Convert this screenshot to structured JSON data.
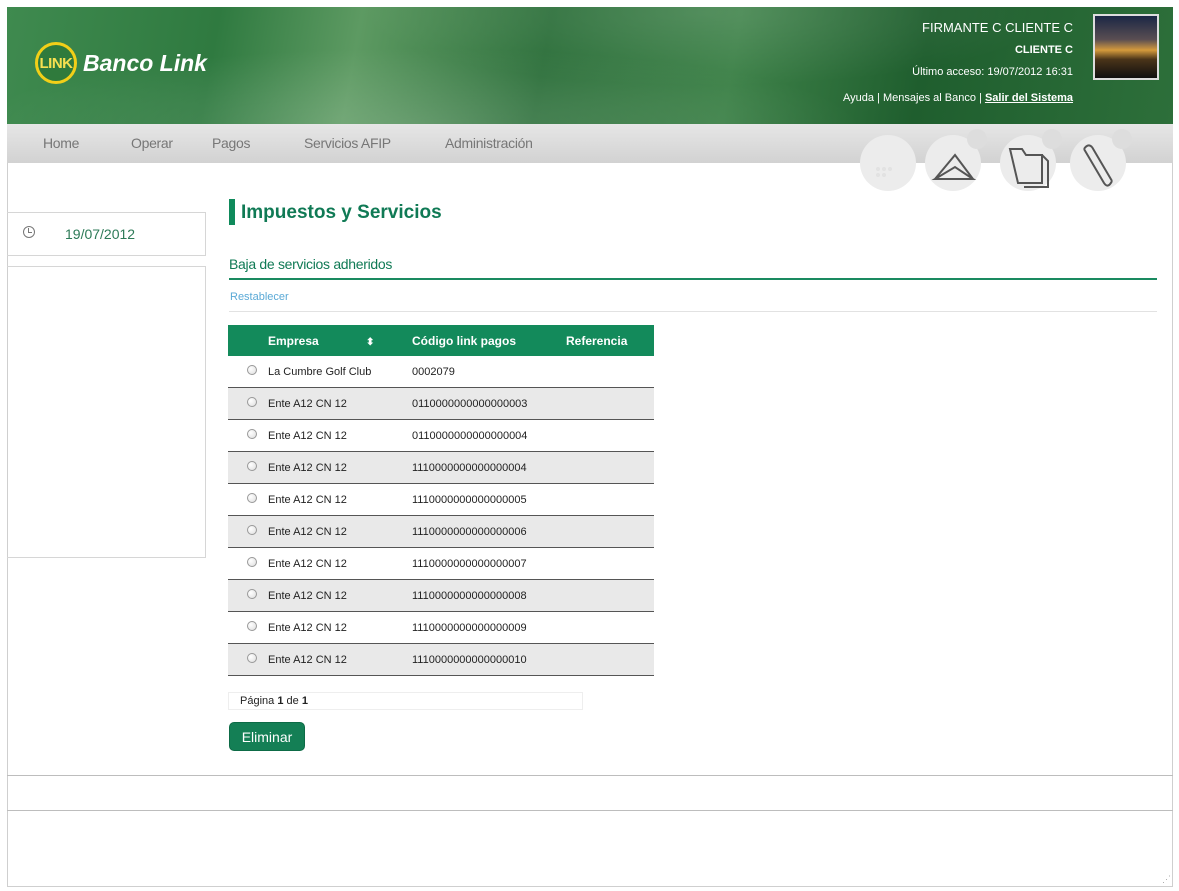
{
  "header": {
    "logo_mark": "LINK",
    "bank_name": "Banco Link",
    "user_name": "FIRMANTE C CLIENTE C",
    "client": "CLIENTE C",
    "last_access": "Último acceso: 19/07/2012 16:31",
    "link_help": "Ayuda",
    "link_messages": "Mensajes al Banco",
    "link_logout": "Salir del Sistema",
    "sep": "|"
  },
  "nav": {
    "items": [
      "Home",
      "Operar",
      "Pagos",
      "Servicios AFIP",
      "Administración"
    ],
    "icons": [
      "calendar-icon",
      "envelope-icon",
      "folder-icon",
      "clip-icon"
    ]
  },
  "sidebar": {
    "date": "19/07/2012"
  },
  "main": {
    "title": "Impuestos y Servicios",
    "subtitle": "Baja de servicios adheridos",
    "reset": "Restablecer",
    "table": {
      "headers": [
        "Empresa",
        "Código link pagos",
        "Referencia"
      ],
      "sort_glyph": "⬍",
      "rows": [
        {
          "empresa": "La Cumbre Golf Club",
          "codigo": "0002079",
          "referencia": ""
        },
        {
          "empresa": "Ente A12 CN 12",
          "codigo": "0110000000000000003",
          "referencia": ""
        },
        {
          "empresa": "Ente A12 CN 12",
          "codigo": "0110000000000000004",
          "referencia": ""
        },
        {
          "empresa": "Ente A12 CN 12",
          "codigo": "1110000000000000004",
          "referencia": ""
        },
        {
          "empresa": "Ente A12 CN 12",
          "codigo": "1110000000000000005",
          "referencia": ""
        },
        {
          "empresa": "Ente A12 CN 12",
          "codigo": "1110000000000000006",
          "referencia": ""
        },
        {
          "empresa": "Ente A12 CN 12",
          "codigo": "1110000000000000007",
          "referencia": ""
        },
        {
          "empresa": "Ente A12 CN 12",
          "codigo": "1110000000000000008",
          "referencia": ""
        },
        {
          "empresa": "Ente A12 CN 12",
          "codigo": "1110000000000000009",
          "referencia": ""
        },
        {
          "empresa": "Ente A12 CN 12",
          "codigo": "1110000000000000010",
          "referencia": ""
        }
      ]
    },
    "pager": {
      "label": "Página",
      "current": "1",
      "of": "de",
      "total": "1"
    },
    "delete_button": "Eliminar"
  },
  "colors": {
    "brand_green": "#138a5b",
    "accent_yellow": "#f2cf18"
  }
}
